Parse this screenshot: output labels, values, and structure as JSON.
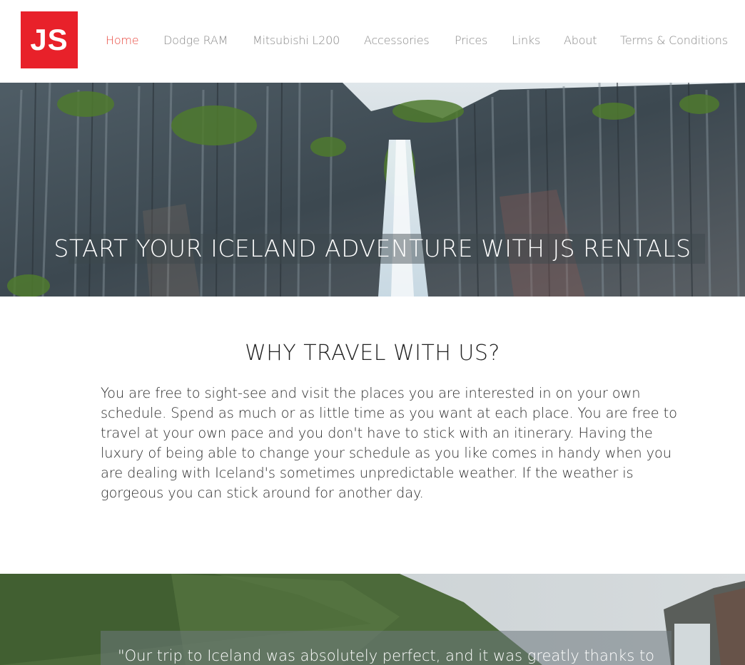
{
  "brand": {
    "logo_text": "JS",
    "color": "#e8212a"
  },
  "nav": {
    "items": [
      {
        "label": "Home",
        "active": true
      },
      {
        "label": "Dodge RAM",
        "active": false
      },
      {
        "label": "Mitsubishi L200",
        "active": false
      },
      {
        "label": "Accessories",
        "active": false
      },
      {
        "label": "Prices",
        "active": false
      },
      {
        "label": "Links",
        "active": false
      },
      {
        "label": "About",
        "active": false
      },
      {
        "label": "Terms & Conditions",
        "active": false
      }
    ],
    "active_color": "#e8473d",
    "inactive_color": "#8a8a8a"
  },
  "hero": {
    "title": "START YOUR ICELAND ADVENTURE WITH JS RENTALS"
  },
  "why": {
    "heading": "WHY TRAVEL WITH US?",
    "body": "You are free to sight-see and visit the places you are interested in on your own schedule. Spend as much or as little time as you want at each place. You are free to travel at your own pace and you don't have to stick with an itinerary. Having the luxury of being able to change your schedule as you like comes in handy when you are dealing with Iceland's sometimes unpredictable weather. If the weather is gorgeous you can stick around for another day."
  },
  "testimonial": {
    "quote_start": "\"Our trip to Iceland was absolutely perfect, and it was greatly thanks to"
  }
}
